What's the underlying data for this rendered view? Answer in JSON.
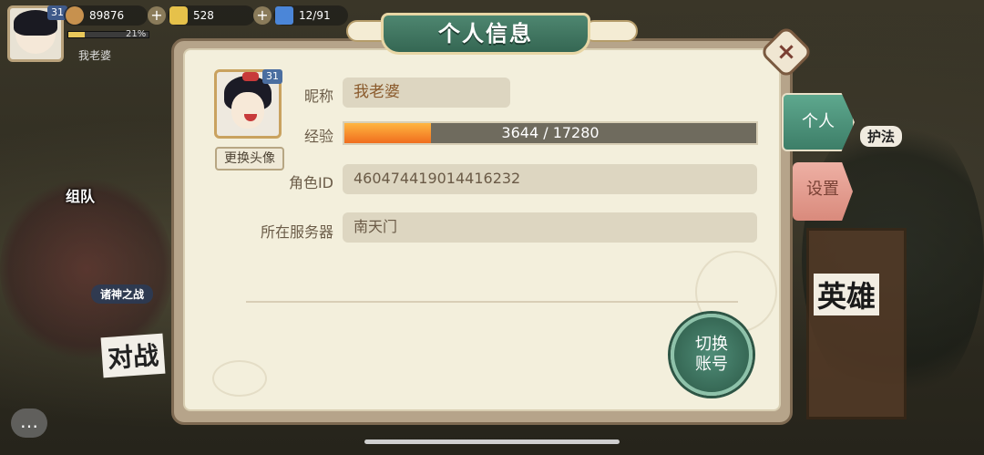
{
  "hud": {
    "level": "31",
    "coins": "89876",
    "gold": "528",
    "energy": "12/91",
    "xp_percent": "21%",
    "xp_fraction": 0.21,
    "player_name": "我老婆"
  },
  "background": {
    "team_label": "组队",
    "battle_mode_label": "诸神之战",
    "fight_label": "对战",
    "guardian_label": "护法",
    "heroes_label": "英雄"
  },
  "dialog": {
    "title": "个人信息",
    "avatar_level": "31",
    "change_avatar_label": "更换头像",
    "nickname_label": "昵称",
    "nickname_value": "我老婆",
    "exp_label": "经验",
    "exp_current": 3644,
    "exp_max": 17280,
    "exp_text": "3644 / 17280",
    "role_id_label": "角色ID",
    "role_id_value": "460474419014416232",
    "server_label": "所在服务器",
    "server_value": "南天门",
    "switch_line1": "切换",
    "switch_line2": "账号"
  },
  "tabs": {
    "personal": "个人",
    "settings": "设置"
  },
  "colors": {
    "panel_bg": "#f3efdc",
    "accent_green": "#3d7e68",
    "settings_pink": "#d98a7c",
    "exp_orange": "#f06d1e"
  }
}
